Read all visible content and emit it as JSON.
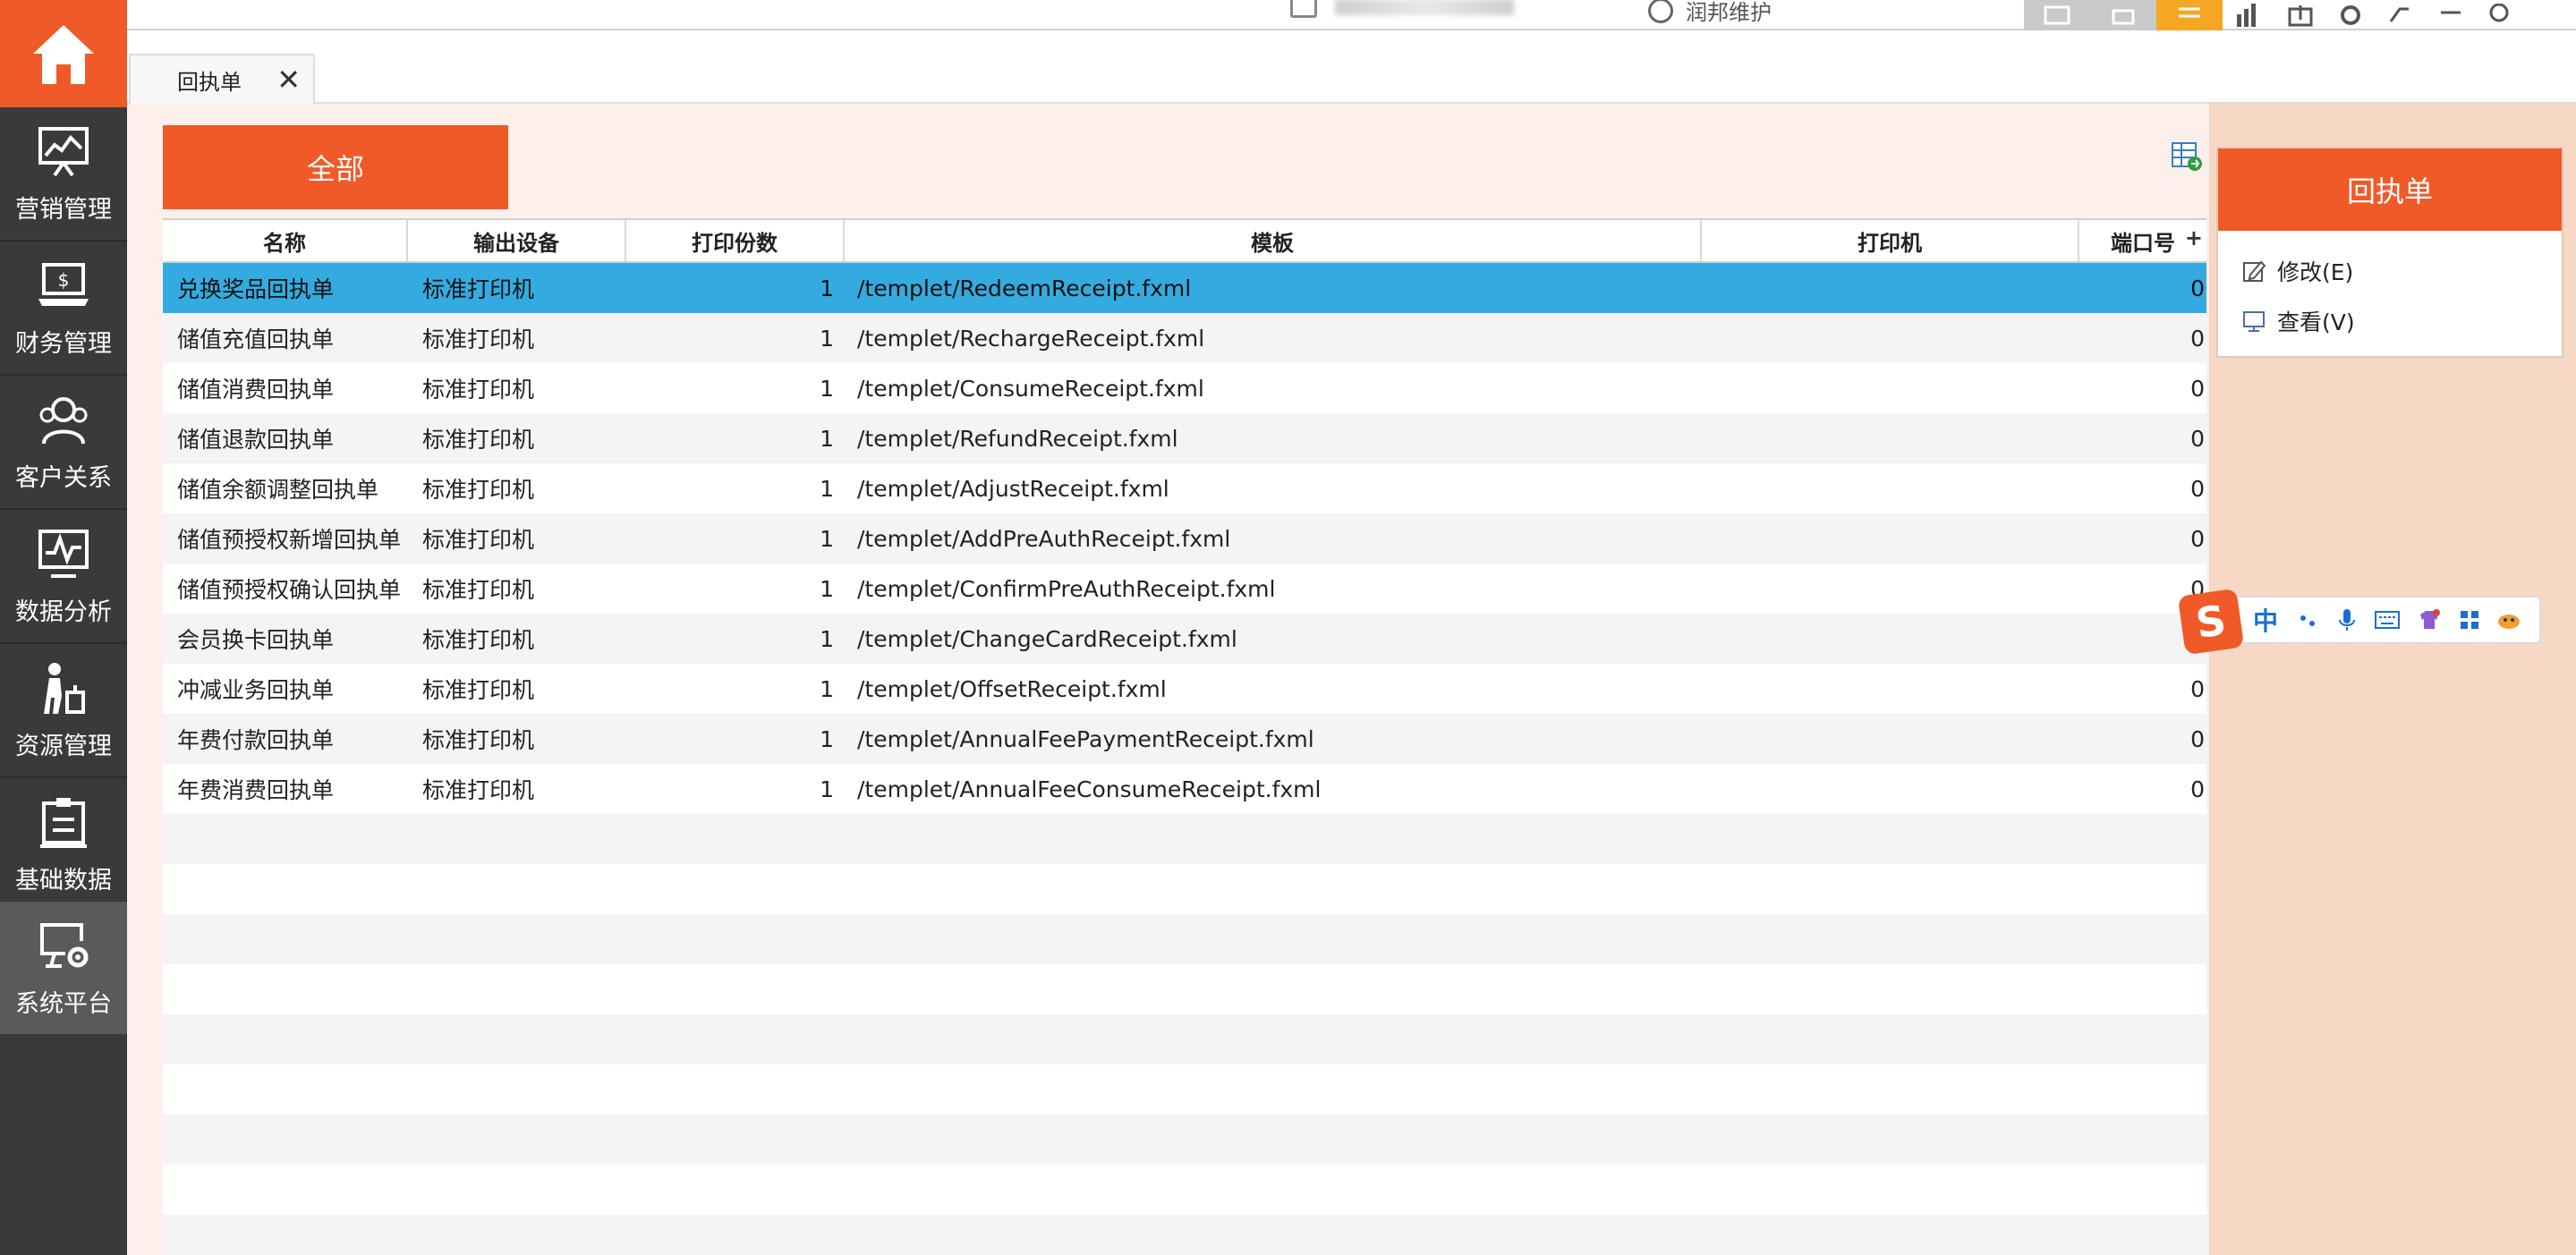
{
  "sidebar": {
    "items": [
      {
        "label": "营销管理",
        "icon": "presentation-chart-icon"
      },
      {
        "label": "财务管理",
        "icon": "laptop-dollar-icon"
      },
      {
        "label": "客户关系",
        "icon": "users-icon"
      },
      {
        "label": "数据分析",
        "icon": "line-chart-icon"
      },
      {
        "label": "资源管理",
        "icon": "person-luggage-icon"
      },
      {
        "label": "基础数据",
        "icon": "clipboard-icon"
      },
      {
        "label": "系统平台",
        "icon": "monitor-gear-icon"
      }
    ],
    "active_index": 6
  },
  "topbar": {
    "user_name": "润邦维护"
  },
  "tabs": [
    {
      "label": "回执单",
      "close": "✕"
    }
  ],
  "toolbar": {
    "filter_label": "全部"
  },
  "table": {
    "columns": [
      "名称",
      "输出设备",
      "打印份数",
      "模板",
      "打印机",
      "端口号"
    ],
    "add_column_symbol": "+",
    "rows": [
      [
        "兑换奖品回执单",
        "标准打印机",
        "1",
        "/templet/RedeemReceipt.fxml",
        "",
        "0"
      ],
      [
        "储值充值回执单",
        "标准打印机",
        "1",
        "/templet/RechargeReceipt.fxml",
        "",
        "0"
      ],
      [
        "储值消费回执单",
        "标准打印机",
        "1",
        "/templet/ConsumeReceipt.fxml",
        "",
        "0"
      ],
      [
        "储值退款回执单",
        "标准打印机",
        "1",
        "/templet/RefundReceipt.fxml",
        "",
        "0"
      ],
      [
        "储值余额调整回执单",
        "标准打印机",
        "1",
        "/templet/AdjustReceipt.fxml",
        "",
        "0"
      ],
      [
        "储值预授权新增回执单",
        "标准打印机",
        "1",
        "/templet/AddPreAuthReceipt.fxml",
        "",
        "0"
      ],
      [
        "储值预授权确认回执单",
        "标准打印机",
        "1",
        "/templet/ConfirmPreAuthReceipt.fxml",
        "",
        "0"
      ],
      [
        "会员换卡回执单",
        "标准打印机",
        "1",
        "/templet/ChangeCardReceipt.fxml",
        "",
        "0"
      ],
      [
        "冲减业务回执单",
        "标准打印机",
        "1",
        "/templet/OffsetReceipt.fxml",
        "",
        "0"
      ],
      [
        "年费付款回执单",
        "标准打印机",
        "1",
        "/templet/AnnualFeePaymentReceipt.fxml",
        "",
        "0"
      ],
      [
        "年费消费回执单",
        "标准打印机",
        "1",
        "/templet/AnnualFeeConsumeReceipt.fxml",
        "",
        "0"
      ]
    ],
    "selected_index": 0
  },
  "right_panel": {
    "title": "回执单",
    "actions": [
      {
        "label": "修改(E)",
        "icon": "edit-icon"
      },
      {
        "label": "查看(V)",
        "icon": "monitor-view-icon"
      }
    ]
  },
  "ime": {
    "logo": "S",
    "mode_label": "中"
  },
  "colors": {
    "accent": "#f05a28",
    "sidebar_bg": "#3a3a3a",
    "selected_row": "#34abe0",
    "main_bg": "#fdf0ea",
    "panel_bg": "#f6d8c4"
  }
}
